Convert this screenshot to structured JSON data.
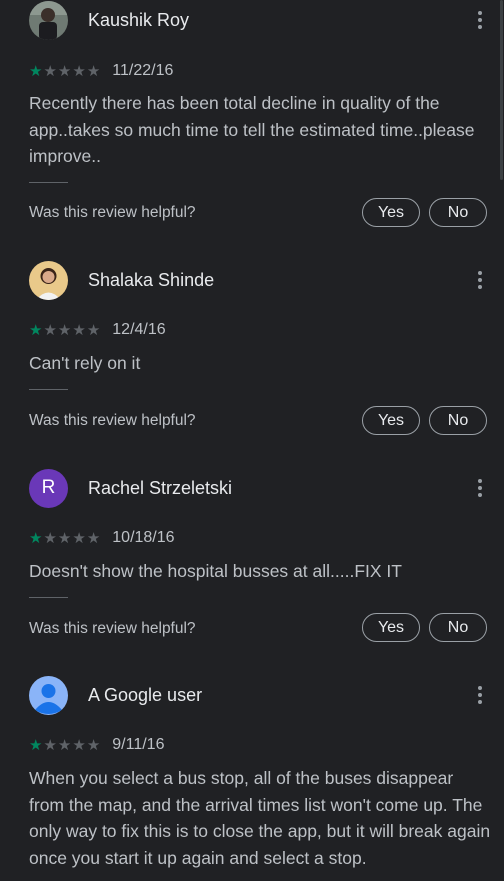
{
  "helpful_prompt": "Was this review helpful?",
  "yes_label": "Yes",
  "no_label": "No",
  "star_color_filled": "#01875f",
  "star_color_empty": "#5f6368",
  "reviews": [
    {
      "name": "Kaushik Roy",
      "rating": 1,
      "date": "11/22/16",
      "text": "Recently there has been total decline in quality of the app..takes so much time to tell the estimated time..please improve..",
      "avatar": "photo"
    },
    {
      "name": "Shalaka Shinde",
      "rating": 1,
      "date": "12/4/16",
      "text": "Can't rely on it",
      "avatar": "photo"
    },
    {
      "name": "Rachel Strzeletski",
      "rating": 1,
      "date": "10/18/16",
      "text": "Doesn't show the hospital busses at all.....FIX IT",
      "avatar": "letter",
      "avatar_letter": "R",
      "avatar_color": "#6a38b8"
    },
    {
      "name": "A Google user",
      "rating": 1,
      "date": "9/11/16",
      "text": "When you select a bus stop, all of the buses disappear from the map, and the arrival times list won't come up. The only way to fix this is to close the app, but it will break again once you start it up again and select a stop.",
      "avatar": "default-user-icon"
    }
  ]
}
